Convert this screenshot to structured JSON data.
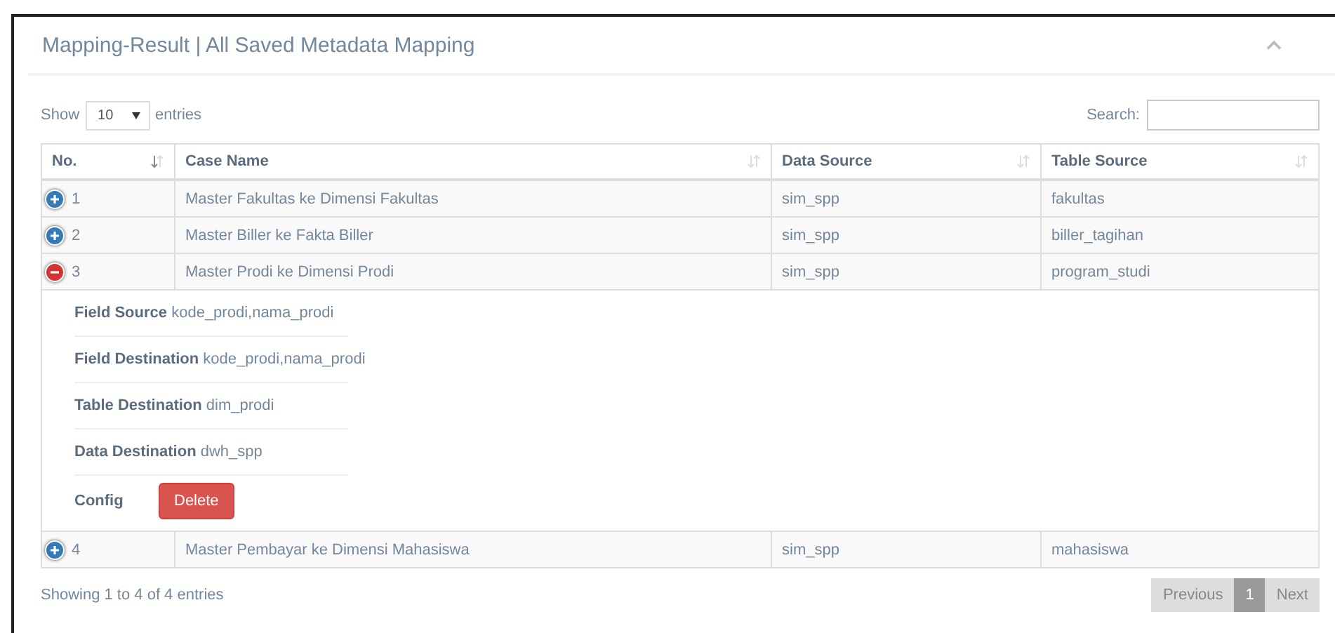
{
  "panel": {
    "title": "Mapping-Result | All Saved Metadata Mapping",
    "collapsed": false
  },
  "length": {
    "label_before": "Show",
    "value": "10",
    "label_after": "entries"
  },
  "search": {
    "label": "Search:"
  },
  "table": {
    "columns": [
      {
        "label": "No.",
        "sorted": true
      },
      {
        "label": "Case Name",
        "sorted": false
      },
      {
        "label": "Data Source",
        "sorted": false
      },
      {
        "label": "Table Source",
        "sorted": false
      }
    ],
    "rows": [
      {
        "cells": [
          "1",
          "Master Fakultas ke Dimensi Fakultas",
          "sim_spp",
          "fakultas"
        ],
        "expanded": false
      },
      {
        "cells": [
          "2",
          "Master Biller ke Fakta Biller",
          "sim_spp",
          "biller_tagihan"
        ],
        "expanded": false
      },
      {
        "cells": [
          "3",
          "Master Prodi ke Dimensi Prodi",
          "sim_spp",
          "program_studi"
        ],
        "expanded": true,
        "details": [
          {
            "label": "Field Source",
            "value": "kode_prodi,nama_prodi"
          },
          {
            "label": "Field Destination",
            "value": "kode_prodi,nama_prodi"
          },
          {
            "label": "Table Destination",
            "value": "dim_prodi"
          },
          {
            "label": "Data Destination",
            "value": "dwh_spp"
          }
        ],
        "config": {
          "label": "Config",
          "button": "Delete"
        }
      },
      {
        "cells": [
          "4",
          "Master Pembayar ke Dimensi Mahasiswa",
          "sim_spp",
          "mahasiswa"
        ],
        "expanded": false
      }
    ]
  },
  "info": "Showing 1 to 4 of 4 entries",
  "pagination": [
    {
      "label": "Previous",
      "kind": "prev",
      "disabled": true
    },
    {
      "label": "1",
      "kind": "page",
      "selected": true
    },
    {
      "label": "Next",
      "kind": "next",
      "disabled": true
    }
  ]
}
